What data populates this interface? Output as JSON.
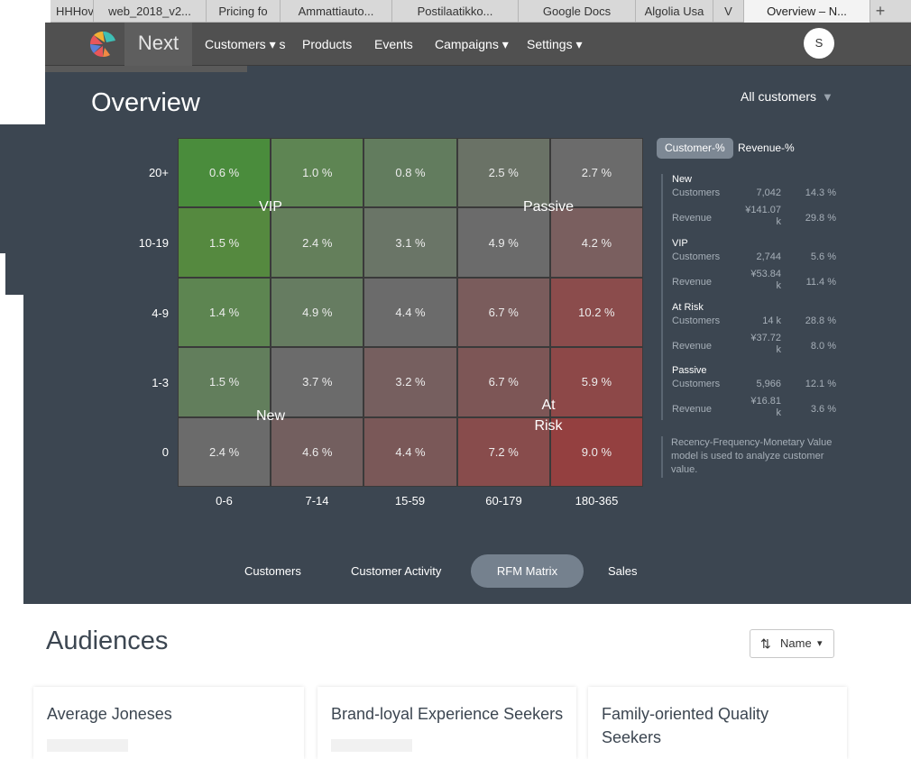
{
  "browser": {
    "tabs": [
      "HHHov",
      "web_2018_v2...",
      "Pricing fo",
      "Ammattiauto...",
      "Postilaatikko...",
      "Google Docs",
      "Algolia Usa",
      "V",
      "Overview – N..."
    ],
    "new_tab": "+"
  },
  "nav": {
    "brand": "Next",
    "items": [
      "Customers ▾ s",
      "Products",
      "Events",
      "Campaigns ▾",
      "Settings ▾"
    ],
    "avatar": "S"
  },
  "overview": {
    "title": "Overview",
    "filter": "All customers",
    "filter_caret": "▼"
  },
  "matrix": {
    "rows": [
      "20+",
      "10-19",
      "4-9",
      "1-3",
      "0"
    ],
    "cols": [
      "0-6",
      "7-14",
      "15-59",
      "60-179",
      "180-365"
    ],
    "cells": [
      [
        "0.6 %",
        "1.0 %",
        "0.8 %",
        "2.5 %",
        "2.7 %"
      ],
      [
        "1.5 %",
        "2.4 %",
        "3.1 %",
        "4.9 %",
        "4.2 %"
      ],
      [
        "1.4 %",
        "4.9 %",
        "4.4 %",
        "6.7 %",
        "10.2 %"
      ],
      [
        "1.5 %",
        "3.7 %",
        "3.2 %",
        "6.7 %",
        "5.9 %"
      ],
      [
        "2.4 %",
        "4.6 %",
        "4.4 %",
        "7.2 %",
        "9.0 %"
      ]
    ],
    "colors": [
      [
        "#4a8c3c",
        "#5e8553",
        "#627c5e",
        "#6a7266",
        "#6b6b6b"
      ],
      [
        "#55893f",
        "#647f5b",
        "#6a7567",
        "#6b6b6b",
        "#7a5f5f"
      ],
      [
        "#5d8551",
        "#667c61",
        "#6b6b6b",
        "#7a5c5c",
        "#8b4c4c"
      ],
      [
        "#627e5c",
        "#6b6b6b",
        "#765f5f",
        "#7d5656",
        "#8d4848"
      ],
      [
        "#6b6b6b",
        "#735f5f",
        "#7a5858",
        "#884c4c",
        "#944040"
      ]
    ],
    "segments": {
      "vip": "VIP",
      "passive": "Passive",
      "new": "New",
      "at_risk_1": "At",
      "at_risk_2": "Risk"
    }
  },
  "toggles": {
    "customer": "Customer-%",
    "revenue": "Revenue-%"
  },
  "stats": {
    "new": {
      "title": "New",
      "customers_label": "Customers",
      "customers": "7,042",
      "customers_pct": "14.3 %",
      "revenue_label": "Revenue",
      "revenue_1": "¥141.07",
      "revenue_2": "k",
      "revenue_pct": "29.8 %"
    },
    "vip": {
      "title": "VIP",
      "customers_label": "Customers",
      "customers": "2,744",
      "customers_pct": "5.6 %",
      "revenue_label": "Revenue",
      "revenue_1": "¥53.84",
      "revenue_2": "k",
      "revenue_pct": "11.4 %"
    },
    "at_risk": {
      "title": "At Risk",
      "customers_label": "Customers",
      "customers": "14 k",
      "customers_pct": "28.8 %",
      "revenue_label": "Revenue",
      "revenue_1": "¥37.72",
      "revenue_2": "k",
      "revenue_pct": "8.0 %"
    },
    "passive": {
      "title": "Passive",
      "customers_label": "Customers",
      "customers": "5,966",
      "customers_pct": "12.1 %",
      "revenue_label": "Revenue",
      "revenue_1": "¥16.81",
      "revenue_2": "k",
      "revenue_pct": "3.6 %"
    }
  },
  "note": "Recency-Frequency-Monetary Value model is used to analyze customer value.",
  "bottom_tabs": [
    "Customers",
    "Customer Activity",
    "RFM Matrix",
    "Sales"
  ],
  "audiences": {
    "title": "Audiences",
    "sort_label": "Name",
    "sort_icon": "⇅",
    "sort_caret": "▾",
    "cards": [
      "Average Joneses",
      "Brand-loyal Experience Seekers",
      "Family-oriented Quality Seekers"
    ]
  }
}
